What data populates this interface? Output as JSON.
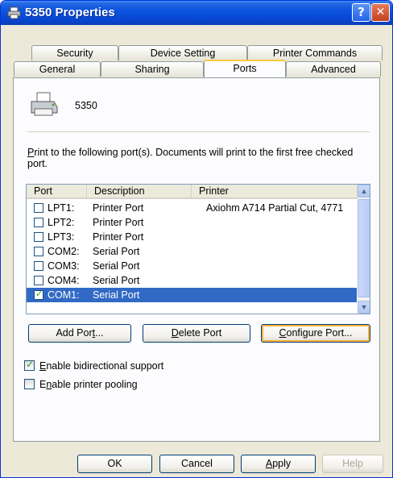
{
  "window": {
    "title": "5350 Properties",
    "help_glyph": "?",
    "close_glyph": "✕"
  },
  "tabs_row1": [
    {
      "label": "Security"
    },
    {
      "label": "Device Setting"
    },
    {
      "label": "Printer Commands"
    }
  ],
  "tabs_row2": [
    {
      "label": "General"
    },
    {
      "label": "Sharing"
    },
    {
      "label": "Ports",
      "active": true
    },
    {
      "label": "Advanced"
    }
  ],
  "printer": {
    "name": "5350"
  },
  "description": {
    "prefix_u": "P",
    "text": "rint to the following port(s). Documents will print to the first free checked port."
  },
  "port_list": {
    "headers": {
      "port": "Port",
      "description": "Description",
      "printer": "Printer"
    },
    "rows": [
      {
        "port": "LPT1:",
        "description": "Printer Port",
        "printer": "Axiohm A714 Partial Cut, 4771",
        "checked": false
      },
      {
        "port": "LPT2:",
        "description": "Printer Port",
        "printer": "",
        "checked": false
      },
      {
        "port": "LPT3:",
        "description": "Printer Port",
        "printer": "",
        "checked": false
      },
      {
        "port": "COM2:",
        "description": "Serial Port",
        "printer": "",
        "checked": false
      },
      {
        "port": "COM3:",
        "description": "Serial Port",
        "printer": "",
        "checked": false
      },
      {
        "port": "COM4:",
        "description": "Serial Port",
        "printer": "",
        "checked": false
      },
      {
        "port": "COM1:",
        "description": "Serial Port",
        "printer": "",
        "checked": true,
        "selected": true
      }
    ]
  },
  "buttons": {
    "add_port": {
      "pre": "Add Por",
      "u": "t",
      "post": "..."
    },
    "delete_port": {
      "pre": "",
      "u": "D",
      "post": "elete Port"
    },
    "configure_port": {
      "pre": "",
      "u": "C",
      "post": "onfigure Port..."
    },
    "ok": "OK",
    "cancel": "Cancel",
    "apply": {
      "pre": "",
      "u": "A",
      "post": "pply"
    },
    "help": "Help"
  },
  "options": {
    "bidirectional": {
      "u": "E",
      "label": "nable bidirectional support",
      "checked": true
    },
    "pooling": {
      "pre": "E",
      "u": "n",
      "label": "able printer pooling",
      "checked": false
    }
  },
  "colors": {
    "title_bar": "#0a54e0",
    "selection": "#316ac5",
    "focus_border": "#f8b33d",
    "panel_bg": "#fcfcfe",
    "dialog_bg": "#ece9d8"
  }
}
